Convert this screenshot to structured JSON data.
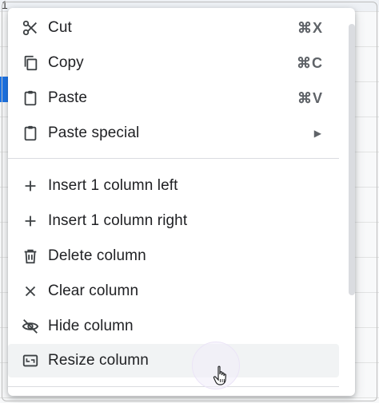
{
  "background": {
    "toolbar_fragment": "1"
  },
  "menu": {
    "items": [
      {
        "label": "Cut",
        "shortcut": "⌘X",
        "icon": "scissors-icon"
      },
      {
        "label": "Copy",
        "shortcut": "⌘C",
        "icon": "copy-icon"
      },
      {
        "label": "Paste",
        "shortcut": "⌘V",
        "icon": "clipboard-icon"
      },
      {
        "label": "Paste special",
        "icon": "clipboard-icon",
        "submenu_indicator": "▶"
      },
      {
        "label": "Insert 1 column left",
        "icon": "plus-icon"
      },
      {
        "label": "Insert 1 column right",
        "icon": "plus-icon"
      },
      {
        "label": "Delete column",
        "icon": "trash-icon"
      },
      {
        "label": "Clear column",
        "icon": "close-icon"
      },
      {
        "label": "Hide column",
        "icon": "eye-off-icon"
      },
      {
        "label": "Resize column",
        "icon": "resize-icon",
        "state": "hovered"
      }
    ]
  },
  "colors": {
    "text": "#202124",
    "secondary_text": "#5f6368",
    "hover_background": "#f1f3f4",
    "divider": "#dadce0",
    "selection_blue": "#1a73e8"
  }
}
